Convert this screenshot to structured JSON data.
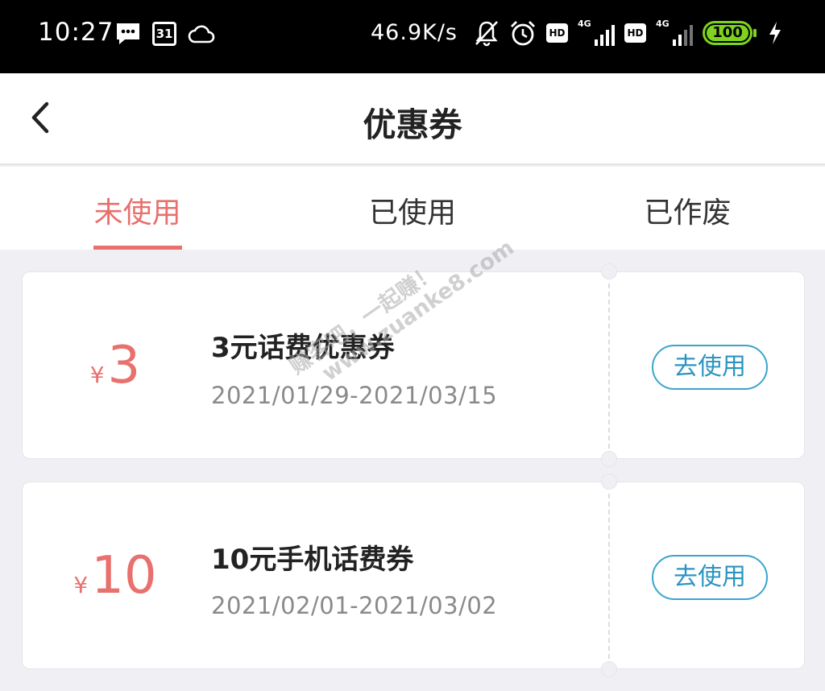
{
  "status_bar": {
    "time": "10:27",
    "calendar_day": "31",
    "net_speed": "46.9K/s",
    "hd_label": "HD",
    "network_type": "4G",
    "battery_level": "100",
    "icons": [
      "message-icon",
      "calendar-icon",
      "cloud-icon",
      "mute-icon",
      "alarm-icon",
      "signal-icon",
      "battery-icon",
      "charging-icon"
    ],
    "battery_color": "#7ed321"
  },
  "header": {
    "title": "优惠券",
    "back_icon": "chevron-left-icon"
  },
  "tabs": [
    {
      "label": "未使用",
      "active": true
    },
    {
      "label": "已使用",
      "active": false
    },
    {
      "label": "已作废",
      "active": false
    }
  ],
  "coupons": [
    {
      "currency": "¥",
      "amount": "3",
      "title": "3元话费优惠券",
      "date_range": "2021/01/29-2021/03/15",
      "action_label": "去使用"
    },
    {
      "currency": "¥",
      "amount": "10",
      "title": "10元手机话费券",
      "date_range": "2021/02/01-2021/03/02",
      "action_label": "去使用"
    }
  ],
  "watermark": {
    "line1": "赚客吧，一起赚！",
    "line2": "www.zuanke8.com"
  },
  "colors": {
    "accent": "#e8706d",
    "button_border": "#3aa5cc",
    "background": "#f0f0f4"
  }
}
